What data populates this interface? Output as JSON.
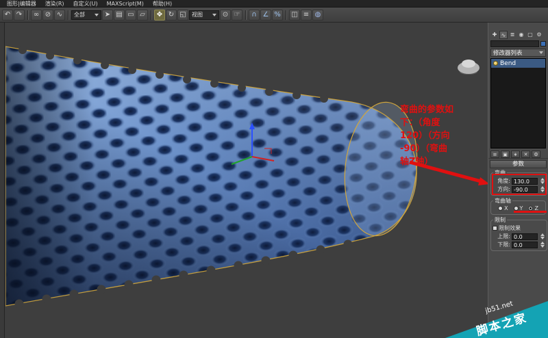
{
  "colors": {
    "tube_blue": "#6e93cb",
    "tube_hole_dark": "#0e1c3c",
    "selection_orange": "#d2a63b",
    "annotation_red": "#e01010",
    "watermark_teal": "#14a3b4",
    "modifier_highlight": "#3b5a83",
    "viewport_bg": "#3e3e3e"
  },
  "menubar": {
    "items": [
      "图形|编辑器",
      "渲染(R)",
      "自定义(U)",
      "MAXScript(M)",
      "帮助(H)"
    ]
  },
  "toolbar": {
    "undo": "↶",
    "redo": "↷",
    "link": "∞",
    "unlink": "⊘",
    "bind": "∿",
    "filter_value": "全部",
    "select": "➤",
    "select_by_name": "▤",
    "region": "▭",
    "crossing": "▱",
    "move": "✥",
    "rotate": "↻",
    "scale": "◱",
    "coord_value": "视图",
    "use_center": "⊙",
    "manipulate": "☞",
    "snap": "∩",
    "angle_snap": "∠",
    "percent_snap": "%",
    "mirror": "◫",
    "align": "≡",
    "render": "◍"
  },
  "viewport": {
    "annotation_lines": [
      "弯曲的参数如",
      "下：（角度",
      "120）（方向",
      "-90）（弯曲",
      "轴Z轴）"
    ]
  },
  "cmdpanel": {
    "tabs": {
      "create": "✚",
      "modify": "∿",
      "hierarchy": "≣",
      "motion": "◉",
      "display": "▢",
      "utilities": "⚙"
    },
    "object_name": "",
    "modifier_dropdown": "修改器列表",
    "stack_item": "Bend",
    "stack_tools": {
      "pin": "≡",
      "show_end": "▣",
      "unique": "∗",
      "remove": "✕",
      "configure": "⚙"
    },
    "params_rollout": "参数",
    "bend": {
      "title": "弯曲",
      "angle_label": "角度:",
      "angle_value": "130.0",
      "direction_label": "方向:",
      "direction_value": "-90.0"
    },
    "axis": {
      "title": "弯曲轴",
      "x": "X",
      "y": "Y",
      "z": "Z",
      "selected": "Z"
    },
    "limits": {
      "title": "限制",
      "effect": "限制效果",
      "upper_label": "上限:",
      "upper_value": "0.0",
      "lower_label": "下限:",
      "lower_value": "0.0"
    }
  },
  "watermark": {
    "site": "jb51.net",
    "brand": "脚本之家"
  }
}
